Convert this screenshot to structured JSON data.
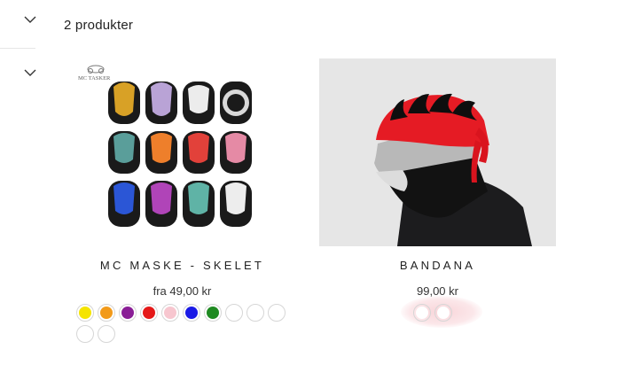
{
  "filters": {
    "toggle_icon": "chevron-down-icon"
  },
  "listing": {
    "count_text": "2 produkter"
  },
  "products": [
    {
      "title": "MC MASKE - SKELET",
      "price": "fra 49,00 kr",
      "logo_text": "MC TASKER",
      "swatches": [
        "#f5e400",
        "#f29a1a",
        "#8a1e96",
        "#e51919",
        "#f7c6cf",
        "#1a1ae6",
        "#1f8a22",
        "#ffffff",
        "#ffffff",
        "#ffffff",
        "#ffffff",
        "#ffffff"
      ]
    },
    {
      "title": "BANDANA",
      "price": "99,00 kr",
      "swatches": [
        "#ffffff",
        "#ffffff"
      ]
    }
  ]
}
